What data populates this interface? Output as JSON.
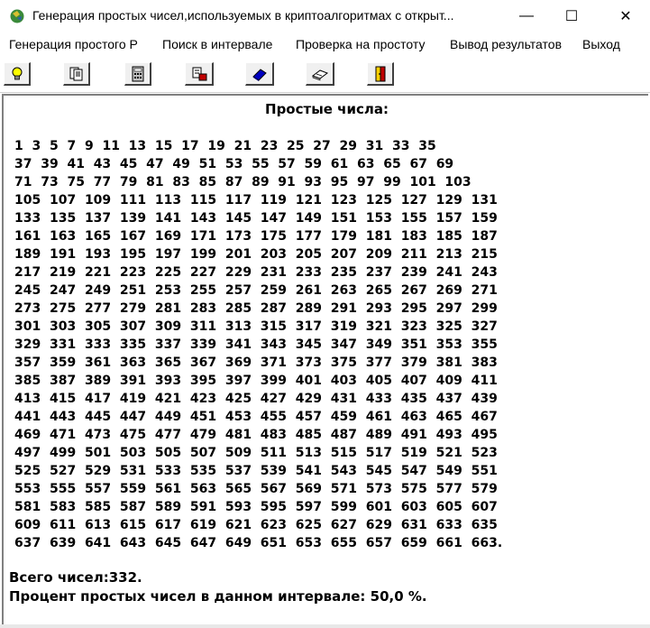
{
  "window": {
    "title": "Генерация простых чисел,используемых в криптоалгоритмах с открыт...",
    "minimize": "—",
    "maximize": "☐",
    "close": "✕"
  },
  "menu": [
    {
      "label": "Генерация простого Р"
    },
    {
      "label": "Поиск в интервале"
    },
    {
      "label": "Проверка на простоту"
    },
    {
      "label": "Вывод результатов"
    },
    {
      "label": "Выход"
    }
  ],
  "toolbar": [
    {
      "icon": "lightbulb-icon"
    },
    {
      "icon": "documents-icon"
    },
    {
      "icon": "calculator-icon"
    },
    {
      "icon": "print-icon"
    },
    {
      "icon": "eraser-icon"
    },
    {
      "icon": "book-icon"
    },
    {
      "icon": "exit-door-icon"
    }
  ],
  "content": {
    "heading": "Простые числа:",
    "lines": [
      "1  3  5  7  9  11  13  15  17  19  21  23  25  27  29  31  33  35",
      "37  39  41  43  45  47  49  51  53  55  57  59  61  63  65  67  69",
      "71  73  75  77  79  81  83  85  87  89  91  93  95  97  99  101  103",
      "105  107  109  111  113  115  117  119  121  123  125  127  129  131",
      "133  135  137  139  141  143  145  147  149  151  153  155  157  159",
      "161  163  165  167  169  171  173  175  177  179  181  183  185  187",
      "189  191  193  195  197  199  201  203  205  207  209  211  213  215",
      "217  219  221  223  225  227  229  231  233  235  237  239  241  243",
      "245  247  249  251  253  255  257  259  261  263  265  267  269  271",
      "273  275  277  279  281  283  285  287  289  291  293  295  297  299",
      "301  303  305  307  309  311  313  315  317  319  321  323  325  327",
      "329  331  333  335  337  339  341  343  345  347  349  351  353  355",
      "357  359  361  363  365  367  369  371  373  375  377  379  381  383",
      "385  387  389  391  393  395  397  399  401  403  405  407  409  411",
      "413  415  417  419  421  423  425  427  429  431  433  435  437  439",
      "441  443  445  447  449  451  453  455  457  459  461  463  465  467",
      "469  471  473  475  477  479  481  483  485  487  489  491  493  495",
      "497  499  501  503  505  507  509  511  513  515  517  519  521  523",
      "525  527  529  531  533  535  537  539  541  543  545  547  549  551",
      "553  555  557  559  561  563  565  567  569  571  573  575  577  579",
      "581  583  585  587  589  591  593  595  597  599  601  603  605  607",
      "609  611  613  615  617  619  621  623  625  627  629  631  633  635",
      "637  639  641  643  645  647  649  651  653  655  657  659  661  663."
    ],
    "total": "Всего чисел:332.",
    "percent": "Процент простых чисел в данном интервале: 50,0 %."
  }
}
